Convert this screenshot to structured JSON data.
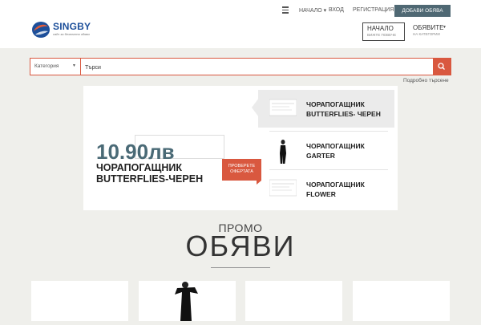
{
  "header": {
    "logo": {
      "name": "SINGBY",
      "tagline": "сайт за безплатни обяви"
    },
    "topnav": [
      {
        "label": "НАЧАЛО"
      },
      {
        "label": "ВХОД"
      },
      {
        "label": "РЕГИСТРАЦИЯ"
      }
    ],
    "add_button": "ДОБАВИ ОБЯВА",
    "nav_boxes": [
      {
        "title": "НАЧАЛО",
        "subtitle": "ВИЖТЕ ПОВЕЧЕ"
      },
      {
        "title": "ОБЯВИТЕ",
        "subtitle": "НА КАТЕГОРИИ"
      }
    ]
  },
  "search": {
    "category_label": "Категория",
    "placeholder": "Търси",
    "advanced": "Подробно търсене"
  },
  "slider": {
    "price": "10.90лв",
    "title": "ЧОРАПОГАЩНИК BUTTERFLIES-ЧЕРЕН",
    "offer_button": "ПРОВЕРЕТЕ ОФЕРТАТА",
    "items": [
      {
        "label": "ЧОРАПОГАЩНИК BUTTERFLIES- ЧЕРЕН",
        "active": true
      },
      {
        "label": "ЧОРАПОГАЩНИК GARTER",
        "active": false
      },
      {
        "label": "ЧОРАПОГАЩНИК FLOWER",
        "active": false
      }
    ]
  },
  "promo": {
    "small": "ПРОМО",
    "big": "ОБЯВИ"
  },
  "colors": {
    "accent": "#d9583f",
    "slate": "#4a6a76",
    "background": "#efefeb"
  }
}
